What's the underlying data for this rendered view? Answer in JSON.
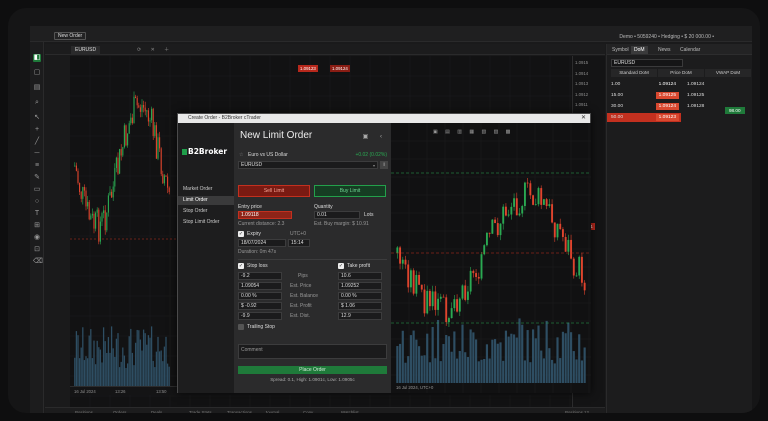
{
  "header": {
    "new_order_label": "New Order",
    "account_text": "Demo • 5059240 • Hedging • $ 20 000.00 •"
  },
  "chart_tab": {
    "label": "EURUSD"
  },
  "top_price_boxes": [
    "1.09123",
    "1.09124"
  ],
  "price_axis": [
    "1.0915",
    "1.0914",
    "1.0913",
    "1.0912",
    "1.0911",
    "1.0910",
    "1.0909",
    "1.0908",
    "1.0907",
    "1.0906",
    "1.0905",
    "1.0904",
    "1.0903",
    "1.0902",
    "1.0901",
    "1.0900",
    "1.0899",
    "1.0898",
    "1.0897",
    "1.0896",
    "1.0895",
    "1.0894",
    "1.0893",
    "1.0892",
    "1.0891",
    "1.0890",
    "1.0889",
    "1.0888",
    "1.0887",
    "1.0886",
    "1.0885",
    "1.0884"
  ],
  "time_axis": [
    "16 Jul 2024",
    "13:26",
    "13:50",
    "13:59",
    "14:08",
    "14:17",
    "14:26",
    "14:35",
    "14:44",
    "14:53",
    "15:02",
    "15:11"
  ],
  "bottom_tabs": [
    "Positions",
    "Orders",
    "Deals",
    "Trade Stats",
    "Transactions",
    "Journal",
    "Copy",
    "Watchlist",
    "Positions 12"
  ],
  "current_price_tag": "1.09121",
  "right_panel": {
    "tabs": [
      "Symbol",
      "DoM",
      "News",
      "Calendar"
    ],
    "symbol": "EURUSD",
    "dom_tabs": [
      "Standard DoM",
      "Price DoM",
      "VWAP DoM"
    ],
    "left_rows": [
      {
        "qty": "1.00",
        "price": "1.09124"
      },
      {
        "qty": "15.00",
        "price": "1.09125"
      },
      {
        "qty": "30.00",
        "price": "1.09124"
      },
      {
        "qty": "50.00",
        "price": "1.09123"
      }
    ],
    "right_rows": [
      {
        "qty": "1.00",
        "price": "1.09124"
      },
      {
        "qty": "",
        "price": "1.09125"
      },
      {
        "qty": "",
        "price": "1.09128"
      }
    ],
    "right_badge": "98.00"
  },
  "dialog": {
    "title": "Create Order - B2Broker cTrader",
    "brand": "B2Broker",
    "order_types": [
      "Market Order",
      "Limit Order",
      "Stop Order",
      "Stop Limit Order"
    ],
    "heading": "New Limit Order",
    "instrument_name": "Euro vs US Dollar",
    "instrument_change": "+0.02 (0.02%)",
    "symbol": "EURUSD",
    "sell_label": "Sell Limit",
    "buy_label": "Buy Limit",
    "entry_price_label": "Entry price",
    "entry_price": "1.09118",
    "current_distance": "Current distance: 2.3",
    "quantity_label": "Quantity",
    "quantity": "0.01",
    "lots_label": "Lots",
    "est_margin": "Est. Buy margin: $ 10.91",
    "expiry_label": "Expiry",
    "timezone": "UTC+0",
    "expiry_date": "18/07/2024",
    "expiry_time": "15:14",
    "duration": "Duration: 0m 47s",
    "stop_loss_label": "Stop loss",
    "take_profit_label": "Take profit",
    "sl_pips": "-9.2",
    "sl_price": "1.09054",
    "sl_balance": "0.00 %",
    "sl_profit": "$ -0.92",
    "sl_dist": "-9.9",
    "mid_labels": [
      "Pips",
      "Est. Price",
      "Est. Balance",
      "Est. Profit",
      "Est. Dist."
    ],
    "tp_pips": "10.6",
    "tp_price": "1.09252",
    "tp_balance": "0.00 %",
    "tp_profit": "$ 1.06",
    "tp_dist": "12.9",
    "trailing_stop_label": "Trailing Stop",
    "comment_placeholder": "Comment",
    "place_order_label": "Place Order",
    "spread_text": "Spread: 0.1, High: 1.0901c, Low: 1.0905c",
    "chart_label": "16 Jul 2024, UTC+0"
  },
  "colors": {
    "bull": "#2aa952",
    "bear": "#e0442d",
    "accent_green": "#1f7a3a",
    "accent_red": "#c3301f"
  }
}
